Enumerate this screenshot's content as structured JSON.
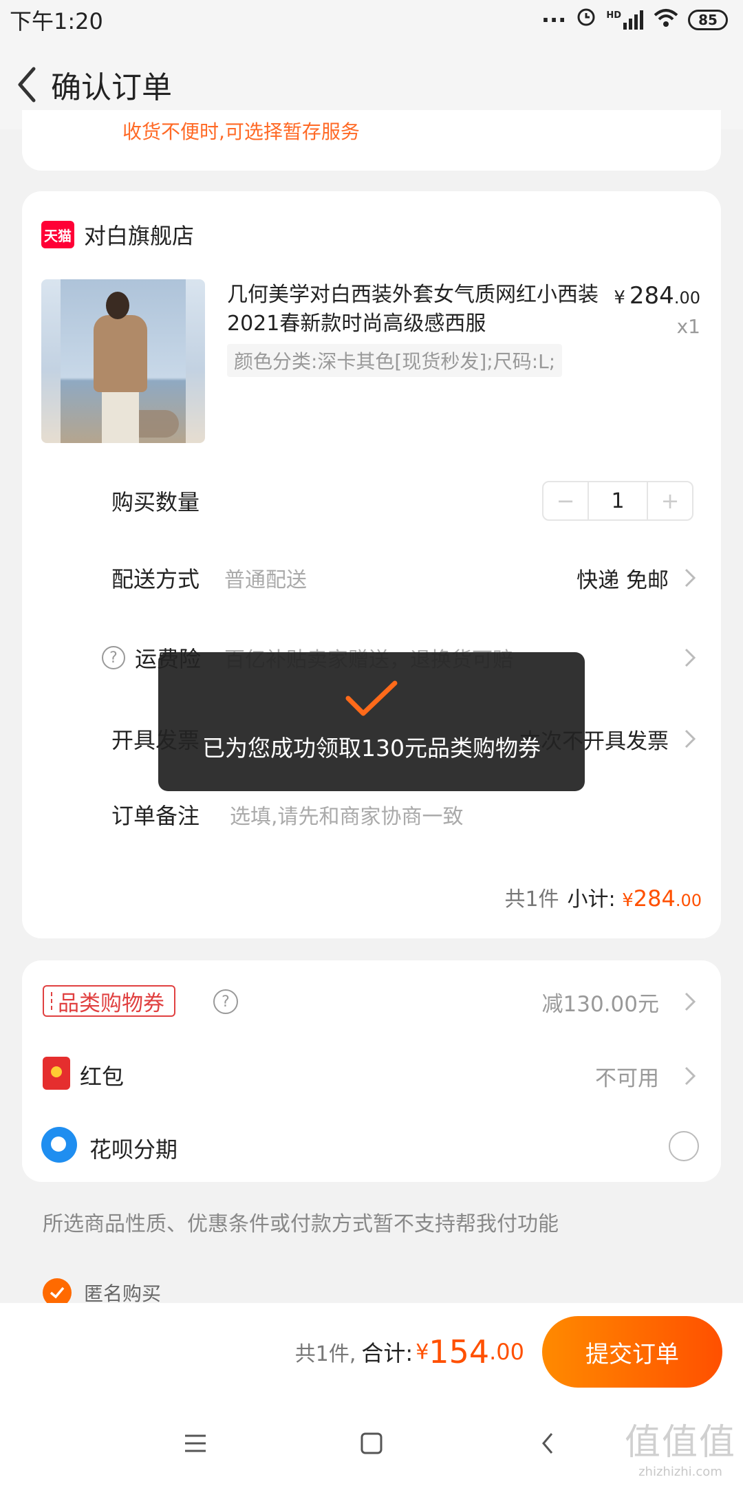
{
  "status_bar": {
    "time": "下午1:20",
    "dots": "···",
    "network": "HD",
    "battery": "85"
  },
  "header": {
    "title": "确认订单"
  },
  "top_card": {
    "text": "收货不便时,可选择暂存服务"
  },
  "shop": {
    "badge": "天猫",
    "name": "对白旗舰店"
  },
  "product": {
    "title": "几何美学对白西装外套女气质网红小西装2021春新款时尚高级感西服",
    "sku": "颜色分类:深卡其色[现货秒发];尺码:L;",
    "price_currency": "¥",
    "price_int": "284",
    "price_dec": ".00",
    "qty": "x1"
  },
  "rows": {
    "quantity": {
      "label": "购买数量",
      "value": "1",
      "minus": "−",
      "plus": "+"
    },
    "delivery": {
      "label": "配送方式",
      "sub": "普通配送",
      "right": "快递 免邮"
    },
    "insurance": {
      "label": "运费险",
      "sub": "百亿补贴卖家赠送，退换货可赔"
    },
    "invoice": {
      "label": "开具发票",
      "right": "本次不开具发票"
    },
    "remark": {
      "label": "订单备注",
      "placeholder": "选填,请先和商家协商一致"
    }
  },
  "subtotal": {
    "count": "共1件",
    "label": "小计:",
    "currency": "¥",
    "amount_int": "284",
    "amount_dec": ".00"
  },
  "benefits": {
    "coupon_label": "品类购物券",
    "coupon_value": "减130.00元",
    "redpack_label": "红包",
    "redpack_value": "不可用",
    "huabei_label": "花呗分期"
  },
  "notice": "所选商品性质、优惠条件或付款方式暂不支持帮我付功能",
  "anonymous": {
    "label": "匿名购买",
    "checked": true
  },
  "bottom": {
    "count": "共1件,",
    "total_label": "合计:",
    "currency": "¥",
    "amount_int": "154",
    "amount_dec": ".00",
    "submit": "提交订单"
  },
  "toast": {
    "message": "已为您成功领取130元品类购物券"
  },
  "watermark": {
    "big": "值值值",
    "small": "zhizhizhi.com"
  },
  "colors": {
    "accent": "#ff5000",
    "tmall": "#ff0036",
    "coupon": "#e04040",
    "huabei": "#1f8ef0"
  }
}
